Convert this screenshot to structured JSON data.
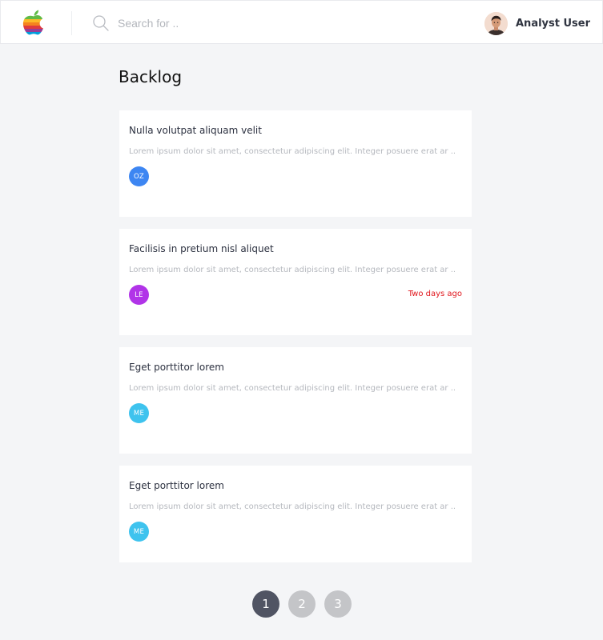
{
  "header": {
    "logo_icon": "apple-rainbow-logo",
    "search": {
      "placeholder": "Search for ..",
      "value": ""
    },
    "user": {
      "name": "Analyst User",
      "avatar_icon": "user-avatar"
    }
  },
  "page": {
    "title": "Backlog"
  },
  "cards": [
    {
      "title": "Nulla volutpat aliquam velit",
      "description": "Lorem ipsum dolor sit amet, consectetur adipiscing elit. Integer posuere erat ar ..",
      "assignee_initials": "OZ",
      "assignee_color": "#3d86f2",
      "due": ""
    },
    {
      "title": "Facilisis in pretium nisl aliquet",
      "description": "Lorem ipsum dolor sit amet, consectetur adipiscing elit. Integer posuere erat ar ..",
      "assignee_initials": "LE",
      "assignee_color": "#b134e8",
      "due": "Two days ago",
      "due_color": "#e0161c"
    },
    {
      "title": "Eget porttitor lorem",
      "description": "Lorem ipsum dolor sit amet, consectetur adipiscing elit. Integer posuere erat ar ..",
      "assignee_initials": "ME",
      "assignee_color": "#3ec3ee",
      "due": ""
    },
    {
      "title": "Eget porttitor lorem",
      "description": "Lorem ipsum dolor sit amet, consectetur adipiscing elit. Integer posuere erat ar ..",
      "assignee_initials": "ME",
      "assignee_color": "#3ec3ee",
      "due": ""
    }
  ],
  "pagination": {
    "pages": [
      "1",
      "2",
      "3"
    ],
    "active": "1"
  }
}
